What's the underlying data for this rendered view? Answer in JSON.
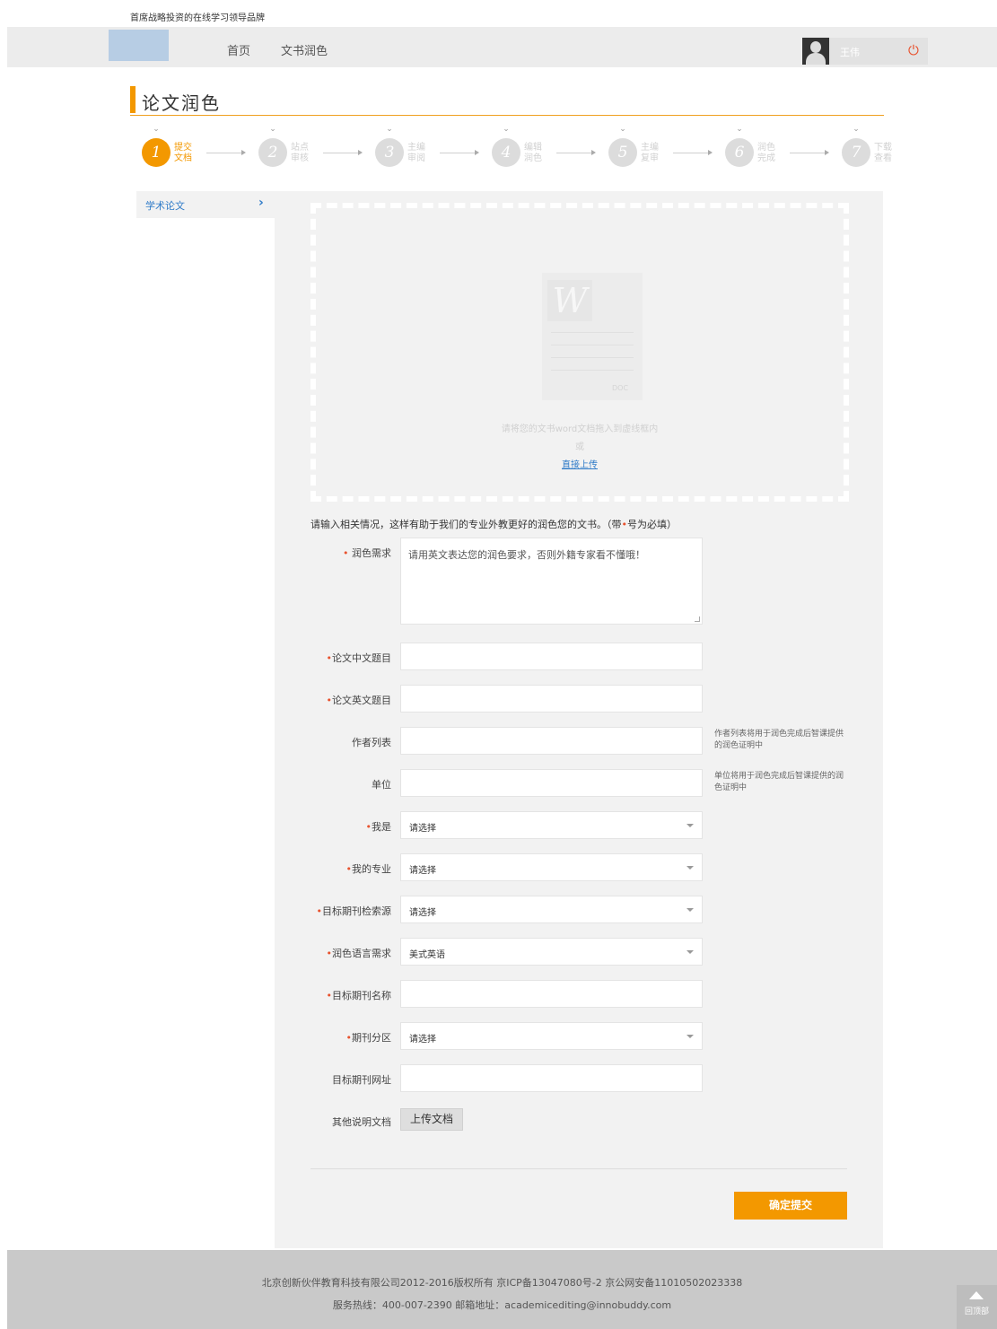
{
  "header": {
    "slogan": "首席战略投资的在线学习领导品牌",
    "nav": [
      "首页",
      "文书润色"
    ],
    "username": "王伟"
  },
  "page_title": "论文润色",
  "steps": [
    {
      "num": "1",
      "label": "提交文档",
      "active": true
    },
    {
      "num": "2",
      "label": "站点审核",
      "active": false
    },
    {
      "num": "3",
      "label": "主编审阅",
      "active": false
    },
    {
      "num": "4",
      "label": "编辑润色",
      "active": false
    },
    {
      "num": "5",
      "label": "主编复审",
      "active": false
    },
    {
      "num": "6",
      "label": "润色完成",
      "active": false
    },
    {
      "num": "7",
      "label": "下载查看",
      "active": false
    }
  ],
  "sidebar": {
    "item": "学术论文"
  },
  "dropzone": {
    "file_ext": "DOC",
    "hint": "请将您的文书word文档拖入到虚线框内",
    "or": "或",
    "upload_link": "直接上传"
  },
  "form": {
    "intro_before": "请输入相关情况，这样有助于我们的专业外教更好的润色您的文书。（带",
    "intro_star": "•",
    "intro_after": "号为必填）",
    "polish_req": {
      "label": "润色需求",
      "placeholder": "请用英文表达您的润色要求，否则外籍专家看不懂哦！"
    },
    "cn_title": {
      "label": "论文中文题目"
    },
    "en_title": {
      "label": "论文英文题目"
    },
    "authors": {
      "label": "作者列表",
      "hint": "作者列表将用于润色完成后智课提供的润色证明中"
    },
    "unit": {
      "label": "单位",
      "hint": "单位将用于润色完成后智课提供的润色证明中"
    },
    "identity": {
      "label": "我是",
      "value": "请选择"
    },
    "major": {
      "label": "我的专业",
      "value": "请选择"
    },
    "journal_index": {
      "label": "目标期刊检索源",
      "value": "请选择"
    },
    "language": {
      "label": "润色语言需求",
      "value": "美式英语"
    },
    "journal_name": {
      "label": "目标期刊名称"
    },
    "journal_zone": {
      "label": "期刊分区",
      "value": "请选择"
    },
    "journal_url": {
      "label": "目标期刊网址"
    },
    "other_docs": {
      "label": "其他说明文档",
      "button": "上传文档"
    },
    "submit": "确定提交"
  },
  "footer": {
    "line1": "北京创新伙伴教育科技有限公司2012-2016版权所有 京ICP备13047080号-2 京公网安备11010502023338",
    "line2": "服务热线：400-007-2390 邮箱地址：academicediting@innobuddy.com"
  },
  "back_to_top": "回顶部"
}
